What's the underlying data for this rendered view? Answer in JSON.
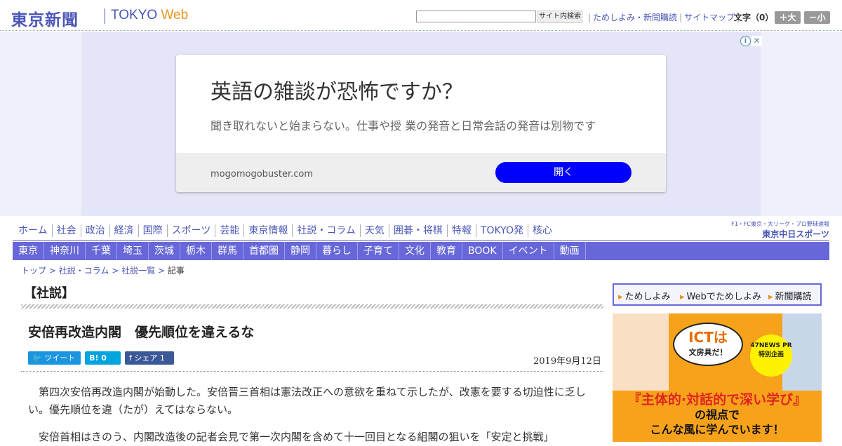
{
  "header": {
    "logo_ja": "東京新聞",
    "logo_en": "TOKYO",
    "logo_web": "Web",
    "search_placeholder": "",
    "search_button": "サイト内検索",
    "links": [
      "ためしよみ・新聞購読",
      "サイトマップ"
    ],
    "fontsize_label": "文字（0）",
    "fontsize_plus": "＋大",
    "fontsize_minus": "－小"
  },
  "ad": {
    "info_glyph": "i",
    "close_glyph": "✕",
    "title": "英語の雑談が恐怖ですか？",
    "description": "聞き取れないと始まらない。仕事や授 業の発音と日常会話の発音は別物です",
    "domain": "mogomogobuster.com",
    "cta": "開く"
  },
  "nav_primary": [
    "ホーム",
    "社会",
    "政治",
    "経済",
    "国際",
    "スポーツ",
    "芸能",
    "東京情報",
    "社説・コラム",
    "天気",
    "囲碁・将棋",
    "特報",
    "TOKYO発",
    "核心"
  ],
  "chunichi_banner": {
    "top": "F1・FC東京・大リーグ・プロ野球速報",
    "bottom": "東京中日スポーツ"
  },
  "nav_secondary": [
    "東京",
    "神奈川",
    "千葉",
    "埼玉",
    "茨城",
    "栃木",
    "群馬",
    "首都圏",
    "静岡",
    "暮らし",
    "子育て",
    "文化",
    "教育",
    "BOOK",
    "イベント",
    "動画"
  ],
  "breadcrumb": {
    "items": [
      "トップ",
      "社説・コラム",
      "社説一覧"
    ],
    "separator": ">",
    "current": "記事"
  },
  "article": {
    "section": "【社説】",
    "headline": "安倍再改造内閣　優先順位を違えるな",
    "share_tweet": "ツイート",
    "share_hatena": "B! 0",
    "share_facebook": "シェア 1",
    "date": "2019年9月12日",
    "paragraphs": [
      "第四次安倍再改造内閣が始動した。安倍晋三首相は憲法改正への意欲を重ねて示したが、改憲を要する切迫性に乏しい。優先順位を違（たが）えてはならない。",
      "安倍首相はきのう、内閣改造後の記者会見で第一次内閣を含めて十一回目となる組閣の狙いを「安定と挑戦」"
    ]
  },
  "sidebar": {
    "links": [
      "ためしよみ",
      "Webでためしよみ",
      "新聞購読"
    ],
    "promo": {
      "bubble_title": "ICTは",
      "bubble_sub": "文房具だ！",
      "badge": "47NEWS PR 特別企画",
      "line1": "『主体的·対話的で深い学び』",
      "line2": "の視点で",
      "line3": "こんな風に学んでいます！"
    }
  }
}
